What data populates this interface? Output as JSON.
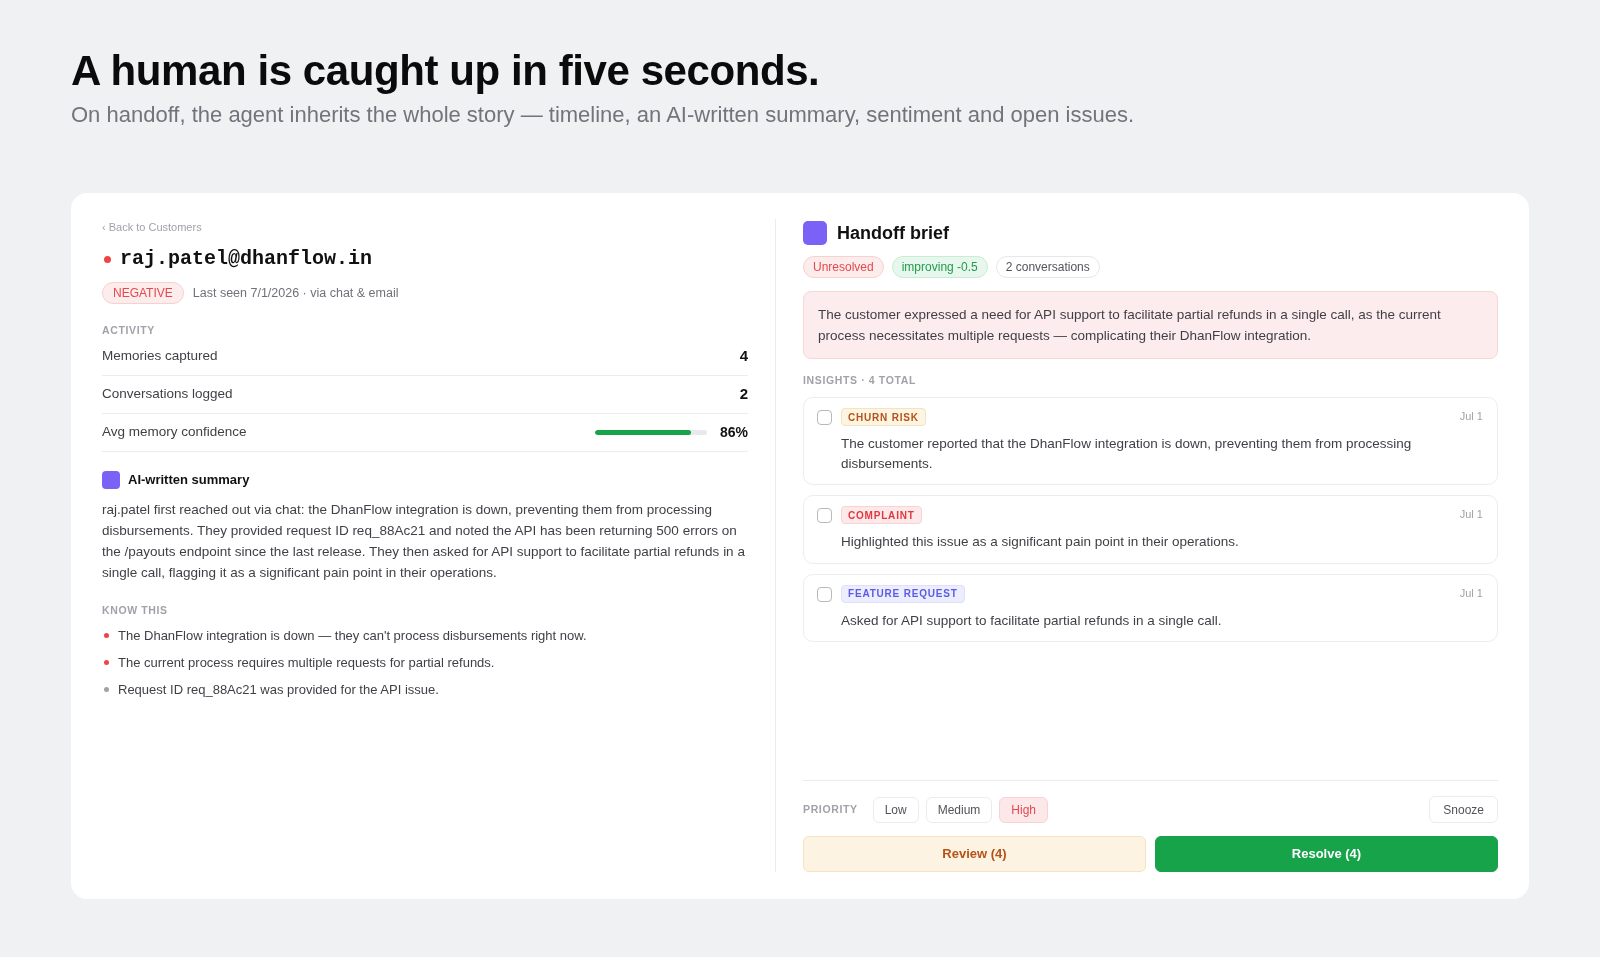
{
  "header": {
    "title": "A human is caught up in five seconds.",
    "subtitle": "On handoff, the agent inherits the whole story — timeline, an AI-written summary, sentiment and open issues."
  },
  "customer": {
    "back_link": "‹ Back to Customers",
    "email": "raj.patel@dhanflow.in",
    "sentiment": {
      "label": "NEGATIVE",
      "kind": "negative"
    },
    "last_seen": "Last seen 7/1/2026 · via chat & email"
  },
  "activity": {
    "label": "ACTIVITY",
    "rows": [
      {
        "kind": "count",
        "label": "Memories captured",
        "value": "4"
      },
      {
        "kind": "count",
        "label": "Conversations logged",
        "value": "2"
      },
      {
        "kind": "meter",
        "label": "Avg memory confidence",
        "value": "86%",
        "level": 0.86
      }
    ]
  },
  "summary": {
    "title": "AI-written summary",
    "text": "raj.patel first reached out via chat: the DhanFlow integration is down, preventing them from processing disbursements. They provided request ID req_88Ac21 and noted the API has been returning 500 errors on the /payouts endpoint since the last release. They then asked for API support to facilitate partial refunds in a single call, flagging it as a significant pain point in their operations."
  },
  "know_this": {
    "label": "KNOW THIS",
    "items": [
      {
        "text": "The DhanFlow integration is down — they can't process disbursements right now.",
        "color": "#ef4444"
      },
      {
        "text": "The current process requires multiple requests for partial refunds.",
        "color": "#ef4444"
      },
      {
        "text": "Request ID req_88Ac21 was provided for the API issue.",
        "color": "#a1a1aa"
      }
    ]
  },
  "brief": {
    "title": "Handoff brief",
    "badges": [
      {
        "label": "Unresolved",
        "kind": "danger"
      },
      {
        "label": "improving -0.5",
        "kind": "success"
      },
      {
        "label": "2 conversations",
        "kind": "neutral"
      }
    ],
    "summary": "The customer expressed a need for API support to facilitate partial refunds in a single call, as the current process necessitates multiple requests — complicating their DhanFlow integration.",
    "insights_label": "INSIGHTS · 4 TOTAL",
    "insights": [
      {
        "tag": "CHURN RISK",
        "kind": "churn",
        "date": "Jul 1",
        "text": "The customer reported that the DhanFlow integration is down, preventing them from processing disbursements.",
        "checked": false
      },
      {
        "tag": "COMPLAINT",
        "kind": "complaint",
        "date": "Jul 1",
        "text": "Highlighted this issue as a significant pain point in their operations.",
        "checked": false
      },
      {
        "tag": "FEATURE REQUEST",
        "kind": "feature",
        "date": "Jul 1",
        "text": "Asked for API support to facilitate partial refunds in a single call.",
        "checked": false
      }
    ]
  },
  "priority": {
    "label": "PRIORITY",
    "options": [
      {
        "label": "Low",
        "selected": false
      },
      {
        "label": "Medium",
        "selected": false
      },
      {
        "label": "High",
        "selected": true
      }
    ],
    "snooze": "Snooze"
  },
  "actions": [
    {
      "label": "Review (4)",
      "kind": "secondary"
    },
    {
      "label": "Resolve (4)",
      "kind": "primary"
    }
  ]
}
